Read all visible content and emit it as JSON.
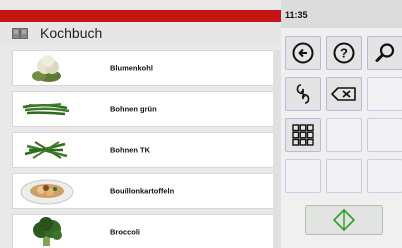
{
  "app": {
    "title": "Kochbuch",
    "book_icon": "book-icon",
    "accent": "#c41414"
  },
  "status": {
    "time": "11:35"
  },
  "recipes": [
    {
      "label": "Blumenkohl",
      "icon": "cauliflower"
    },
    {
      "label": "Bohnen grün",
      "icon": "green-beans"
    },
    {
      "label": "Bohnen TK",
      "icon": "green-beans-frozen"
    },
    {
      "label": "Bouillonkartoffeln",
      "icon": "broth-potatoes-plate"
    },
    {
      "label": "Broccoli",
      "icon": "broccoli"
    }
  ],
  "keypad": {
    "keys": [
      "back-arrow-icon",
      "help-icon",
      "search-icon",
      "link-icon",
      "backspace-icon",
      "grid-icon"
    ],
    "start_icon": "start-diamond-icon"
  }
}
